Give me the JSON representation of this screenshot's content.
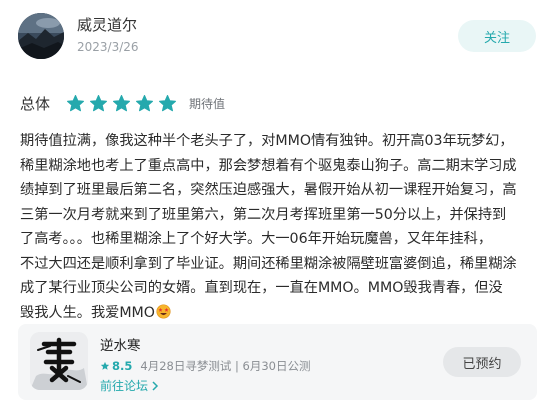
{
  "user": {
    "name": "威灵道尔",
    "date": "2023/3/26",
    "follow_label": "关注"
  },
  "rating": {
    "label": "总体",
    "stars": 5,
    "max_stars": 5,
    "text": "期待值",
    "star_color": "#25a9ad"
  },
  "review": {
    "lines": [
      "期待值拉满，像我这种半个老头子了，对MMO情有独钟。初开高03年玩梦幻，",
      "稀里糊涂地也考上了重点高中，那会梦想着有个驱鬼泰山狗子。高二期末学习成",
      "绩掉到了班里最后第二名，突然压迫感强大，暑假开始从初一课程开始复习，高",
      "三第一次月考就来到了班里第六，第二次月考挥班里第一50分以上，并保持到",
      "了高考。。。也稀里糊涂上了个好大学。大一06年开始玩魔兽，又年年挂科，",
      "不过大四还是顺利拿到了毕业证。期间还稀里糊涂被隔壁班富婆倒追，稀里糊涂",
      "成了某行业顶尖公司的女婿。直到现在，一直在MMO。MMO毁我青春，但没",
      "毁我人生。我爱MMO"
    ],
    "trailing_emoji": "star-struck-emoji"
  },
  "game": {
    "name": "逆水寒",
    "score": "8.5",
    "events": "4月28日寻梦测试 | 6月30日公测",
    "forum_label": "前往论坛",
    "reserve_label": "已预约",
    "accent_color": "#25a9ad"
  }
}
